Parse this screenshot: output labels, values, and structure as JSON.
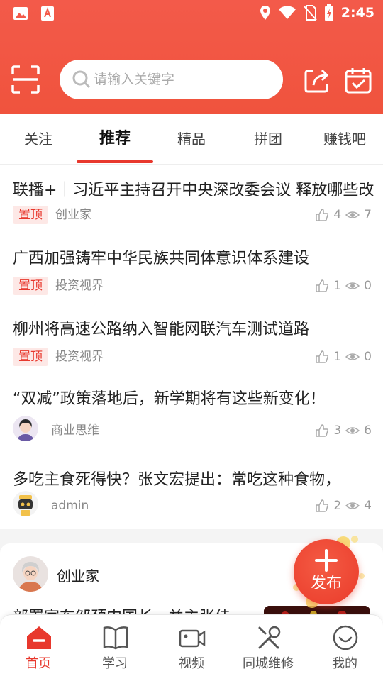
{
  "status_bar": {
    "time": "2:45"
  },
  "search": {
    "placeholder": "请输入关键字"
  },
  "tabs": [
    {
      "label": "关注"
    },
    {
      "label": "推荐",
      "active": true
    },
    {
      "label": "精品"
    },
    {
      "label": "拼团"
    },
    {
      "label": "赚钱吧"
    }
  ],
  "feed": [
    {
      "title": "联播+｜习近平主持召开中央深改委会议 释放哪些改革信号?",
      "tag": "置顶",
      "source": "创业家",
      "likes": "4",
      "views": "7"
    },
    {
      "title": "广西加强铸牢中华民族共同体意识体系建设",
      "tag": "置顶",
      "source": "投资视界",
      "likes": "1",
      "views": "0"
    },
    {
      "title": "柳州将高速公路纳入智能网联汽车测试道路",
      "tag": "置顶",
      "source": "投资视界",
      "likes": "1",
      "views": "0"
    },
    {
      "title": "“双减”政策落地后，新学期将有这些新变化！",
      "source": "商业思维",
      "likes": "3",
      "views": "6"
    },
    {
      "title": "多吃主食死得快？张文宏提出：常吃这种食物，",
      "source": "admin",
      "likes": "2",
      "views": "4"
    }
  ],
  "card": {
    "author": "创业家",
    "title": "部署宣布邹颈中国长...并主张佳"
  },
  "fab": {
    "label": "发布"
  },
  "bottom_nav": [
    {
      "label": "首页",
      "icon": "home-icon",
      "active": true
    },
    {
      "label": "学习",
      "icon": "book-icon"
    },
    {
      "label": "视频",
      "icon": "video-icon"
    },
    {
      "label": "同城维修",
      "icon": "tools-icon"
    },
    {
      "label": "我的",
      "icon": "smile-icon"
    }
  ],
  "colors": {
    "brand": "#f0533d",
    "accent": "#e8382d",
    "tag_bg": "#fde8e6"
  }
}
